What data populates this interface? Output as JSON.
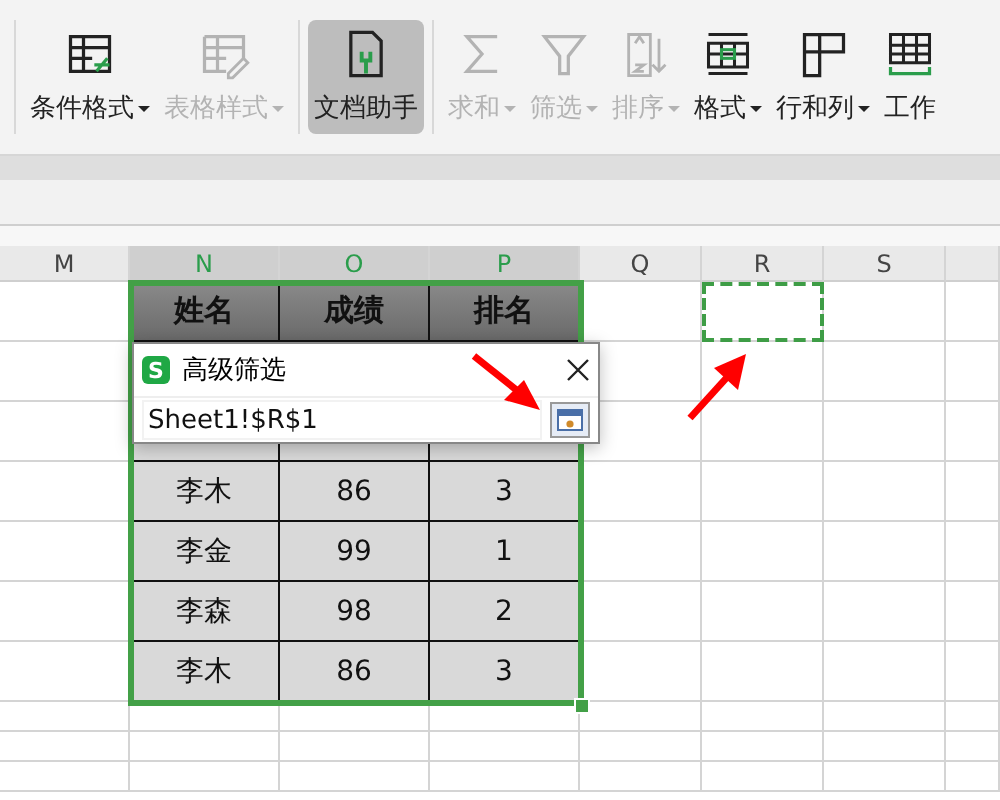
{
  "toolbar": {
    "groups": [
      [
        {
          "label": "条件格式",
          "dropdown": true,
          "disabled": false,
          "selected": false
        },
        {
          "label": "表格样式",
          "dropdown": true,
          "disabled": true,
          "selected": false
        }
      ],
      [
        {
          "label": "文档助手",
          "dropdown": false,
          "disabled": false,
          "selected": true
        }
      ],
      [
        {
          "label": "求和",
          "dropdown": true,
          "disabled": true,
          "selected": false
        },
        {
          "label": "筛选",
          "dropdown": true,
          "disabled": true,
          "selected": false
        },
        {
          "label": "排序",
          "dropdown": true,
          "disabled": true,
          "selected": false
        },
        {
          "label": "格式",
          "dropdown": true,
          "disabled": false,
          "selected": false
        },
        {
          "label": "行和列",
          "dropdown": true,
          "disabled": false,
          "selected": false
        },
        {
          "label": "工作",
          "dropdown": false,
          "disabled": false,
          "selected": false
        }
      ]
    ]
  },
  "sheet": {
    "columns": [
      {
        "label": "M",
        "selected": false,
        "copy_marquee": false
      },
      {
        "label": "N",
        "selected": true,
        "copy_marquee": false
      },
      {
        "label": "O",
        "selected": true,
        "copy_marquee": false
      },
      {
        "label": "P",
        "selected": true,
        "copy_marquee": false
      },
      {
        "label": "Q",
        "selected": false,
        "copy_marquee": false
      },
      {
        "label": "R",
        "selected": false,
        "copy_marquee": true
      },
      {
        "label": "S",
        "selected": false,
        "copy_marquee": false
      }
    ],
    "table": {
      "header": [
        "姓名",
        "成绩",
        "排名"
      ],
      "rows": [
        [
          "李木",
          "86",
          "3"
        ],
        [
          "李金",
          "99",
          "1"
        ],
        [
          "李森",
          "98",
          "2"
        ],
        [
          "李木",
          "86",
          "3"
        ]
      ]
    }
  },
  "dialog": {
    "app_icon_letter": "S",
    "title": "高级筛选",
    "value": "Sheet1!$R$1"
  }
}
